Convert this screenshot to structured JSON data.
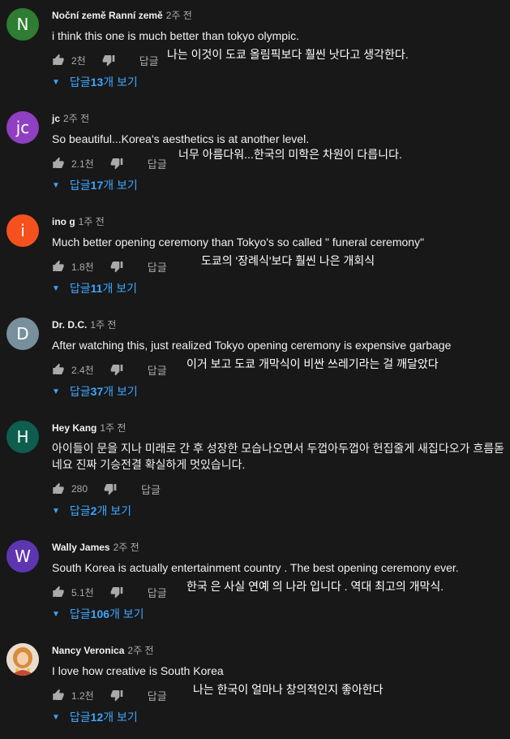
{
  "labels": {
    "reply": "답글",
    "view_prefix": "답글 ",
    "view_suffix": "개 보기"
  },
  "comments": [
    {
      "avatar_letter": "N",
      "avatar_color": "#2e7d32",
      "author": "Noční země Ranní země",
      "time": "2주 전",
      "text": "i think this one is much better than tokyo olympic.",
      "likes": "2천",
      "translation": "나는 이것이 도쿄 올림픽보다 훨씬 낫다고 생각한다.",
      "reply_count": "13"
    },
    {
      "avatar_letter": "jc",
      "avatar_color": "#8e3fc2",
      "author": "jc",
      "time": "2주 전",
      "text": "So beautiful...Korea's aesthetics is at another level.",
      "likes": "2.1천",
      "translation": "너무 아름다워...한국의 미학은 차원이 다릅니다.",
      "reply_count": "17"
    },
    {
      "avatar_letter": "i",
      "avatar_color": "#f4511e",
      "author": "ino g",
      "time": "1주 전",
      "text": "Much better opening ceremony than Tokyo's so called \" funeral ceremony\"",
      "likes": "1.8천",
      "translation": "도쿄의 '장례식'보다 훨씬 나은 개회식",
      "reply_count": "11"
    },
    {
      "avatar_letter": "D",
      "avatar_color": "#78909c",
      "author": "Dr. D.C.",
      "time": "1주 전",
      "text": "After watching this, just realized Tokyo opening ceremony is expensive garbage",
      "likes": "2.4천",
      "translation": "이거 보고 도쿄 개막식이 비싼 쓰레기라는 걸 깨달았다",
      "reply_count": "37"
    },
    {
      "avatar_letter": "H",
      "avatar_color": "#0d5e4e",
      "author": "Hey Kang",
      "time": "1주 전",
      "text": "아이들이 문을 지나 미래로 간 후 성장한 모습나오면서 두껍아두껍아 헌집줄게 새집다오가 흐름돋네요 진짜 기승전결 확실하게 멋있습니다.",
      "likes": "280",
      "translation": "",
      "reply_count": "2"
    },
    {
      "avatar_letter": "W",
      "avatar_color": "#5e35b1",
      "author": "Wally James",
      "time": "2주 전",
      "text": "South Korea is actually entertainment country . The best opening ceremony ever.",
      "likes": "5.1천",
      "translation": "한국 은 사실 연예 의 나라 입니다 . 역대 최고의 개막식.",
      "reply_count": "106"
    },
    {
      "avatar_letter": "",
      "avatar_color": "#e8d9c8",
      "author": "Nancy Veronica",
      "time": "2주 전",
      "text": "I love how creative is South Korea",
      "likes": "1.2천",
      "translation": "나는 한국이 얼마나 창의적인지 좋아한다",
      "reply_count": "12"
    }
  ]
}
